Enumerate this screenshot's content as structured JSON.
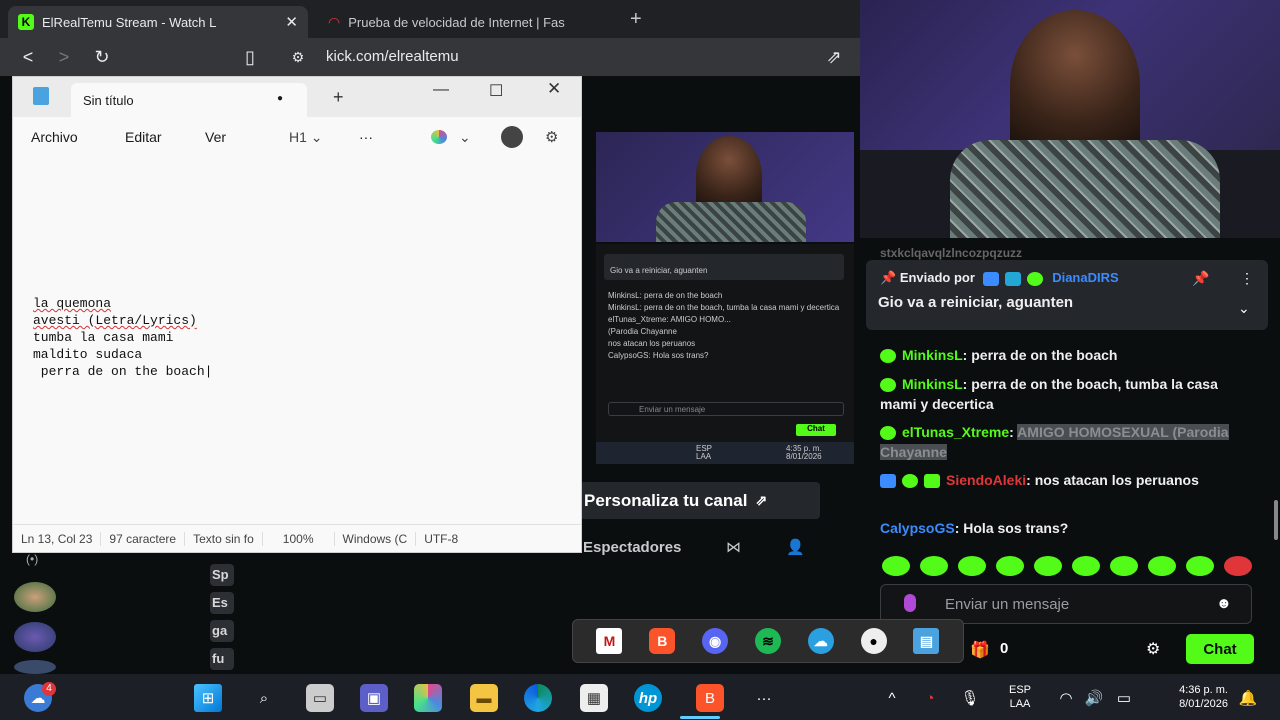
{
  "browser": {
    "tabs": [
      {
        "title": "ElRealTemu Stream - Watch L",
        "active": true
      },
      {
        "title": "Prueba de velocidad de Internet | Fas",
        "active": false
      }
    ],
    "url": "kick.com/elrealtemu"
  },
  "notepad": {
    "tab_title": "Sin título",
    "menu": [
      "Archivo",
      "Editar",
      "Ver"
    ],
    "heading_select": "H1",
    "lines": [
      "la quemona",
      "avesti (Letra/Lyrics)",
      "tumba la casa mami",
      "maldito sudaca",
      " perra de on the boach"
    ],
    "status": {
      "position": "Ln 13, Col 23",
      "chars": "97 caractere",
      "format": "Texto sin fo",
      "zoom": "100%",
      "line_ending": "Windows (C",
      "encoding": "UTF-8"
    }
  },
  "stream": {
    "customize_label": "Personaliza tu canal",
    "spectators_label": "Espectadores",
    "viewer_pills": [
      "Sp",
      "Es",
      "ga",
      "fu"
    ]
  },
  "chat": {
    "top_cutoff": "stxkclqavqlzlncozpqzuzz",
    "pinned": {
      "sent_by": "Enviado por",
      "user": "DianaDIRS",
      "message": "Gio va a reiniciar, aguanten"
    },
    "messages": [
      {
        "user": "MinkinsL",
        "text": "perra de on the boach",
        "color": "#53fc18"
      },
      {
        "user": "MinkinsL",
        "text": "perra de on the boach, tumba la casa mami y decertica",
        "color": "#53fc18"
      },
      {
        "user": "elTunas_Xtreme",
        "text": "AMIGO HOMOSEXUAL (Parodia Chayanne",
        "color": "#53fc18",
        "spoiler": true
      },
      {
        "user": "SiendoAleki",
        "text": "nos atacan los peruanos",
        "color": "#e0363a"
      },
      {
        "user": "CalypsoGS",
        "text": "Hola sos trans?",
        "color": "#3b8cff"
      }
    ],
    "input_placeholder": "Enviar un mensaje",
    "count": "0",
    "chat_button": "Chat"
  },
  "mini_chat": {
    "pinned": "Gio va a reiniciar, aguanten",
    "lines": [
      "MinkinsL: perra de on the boach",
      "MinkinsL: perra de on the boach, tumba la casa mami y decertica",
      "elTunas_Xtreme: AMIGO HOMO...",
      "(Parodia Chayanne",
      "nos atacan los peruanos",
      "CalypsoGS: Hola sos trans?"
    ],
    "input": "Enviar un mensaje",
    "button": "Chat",
    "lang": "ESP LAA",
    "time": "4:35 p. m. 8/01/2026"
  },
  "taskbar": {
    "notification_badge": "4",
    "lang_top": "ESP",
    "lang_bottom": "LAA",
    "time": "4:36 p. m.",
    "date": "8/01/2026"
  },
  "colors": {
    "kick_green": "#53fc18",
    "chat_bg": "#0b0e0f",
    "pinned_bg": "#24272c"
  }
}
